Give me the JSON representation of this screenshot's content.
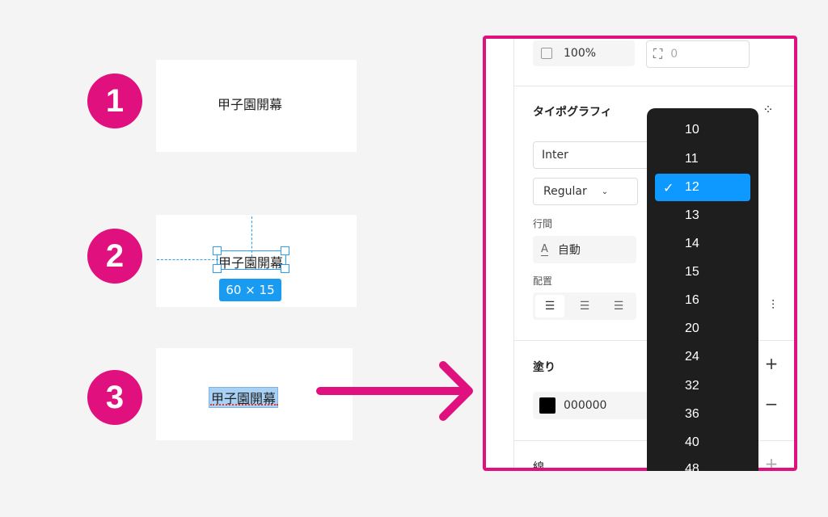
{
  "steps": [
    {
      "badge": "1",
      "text": "甲子園開幕"
    },
    {
      "badge": "2",
      "text": "甲子園開幕",
      "size_tag": "60 × 15"
    },
    {
      "badge": "3",
      "text": "甲子園開幕"
    }
  ],
  "panel": {
    "opacity_value": "100%",
    "radius_value": "0",
    "typography_title": "タイポグラフィ",
    "font_family": "Inter",
    "font_style": "Regular",
    "line_height_label": "行間",
    "line_height_value": "自動",
    "alignment_label": "配置",
    "fill_title": "塗り",
    "fill_color_hex": "000000",
    "stroke_title": "線"
  },
  "font_size_dropdown": {
    "options": [
      "10",
      "11",
      "12",
      "13",
      "14",
      "15",
      "16",
      "20",
      "24",
      "32",
      "36",
      "40",
      "48"
    ],
    "selected": "12"
  },
  "colors": {
    "badge": "#e0117f",
    "highlight_border": "#e0117f",
    "selection_blue": "#1a9bf2",
    "dropdown_bg": "#1e1e1e",
    "dropdown_selected": "#0d99ff"
  }
}
